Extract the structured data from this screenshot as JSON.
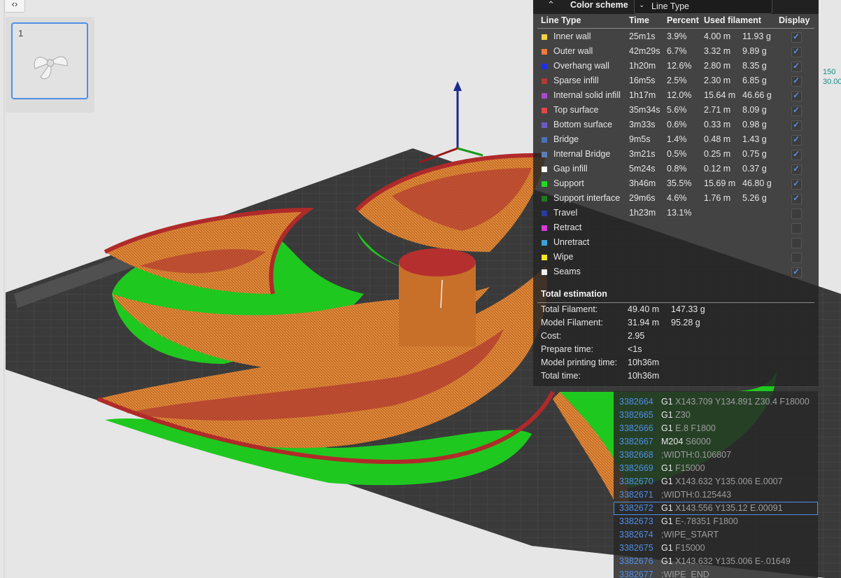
{
  "sidebar": {
    "collapse_icon": "‹›",
    "plate_number": "1"
  },
  "ruler": {
    "top": "150",
    "bottom": "30.00"
  },
  "legend": {
    "scheme_label": "Color scheme",
    "scheme_value": "Line Type",
    "headers": {
      "type": "Line Type",
      "time": "Time",
      "percent": "Percent",
      "used": "Used filament",
      "display": "Display"
    },
    "rows": [
      {
        "name": "Inner wall",
        "color": "#f5d33e",
        "time": "25m1s",
        "percent": "3.9%",
        "length": "4.00 m",
        "weight": "11.93 g",
        "display": true
      },
      {
        "name": "Outer wall",
        "color": "#f07c38",
        "time": "42m29s",
        "percent": "6.7%",
        "length": "3.32 m",
        "weight": "9.89 g",
        "display": true
      },
      {
        "name": "Overhang wall",
        "color": "#1f2ee8",
        "time": "1h20m",
        "percent": "12.6%",
        "length": "2.80 m",
        "weight": "8.35 g",
        "display": true
      },
      {
        "name": "Sparse infill",
        "color": "#b23a35",
        "time": "16m5s",
        "percent": "2.5%",
        "length": "2.30 m",
        "weight": "6.85 g",
        "display": true
      },
      {
        "name": "Internal solid infill",
        "color": "#a54bcf",
        "time": "1h17m",
        "percent": "12.0%",
        "length": "15.64 m",
        "weight": "46.66 g",
        "display": true
      },
      {
        "name": "Top surface",
        "color": "#e84545",
        "time": "35m34s",
        "percent": "5.6%",
        "length": "2.71 m",
        "weight": "8.09 g",
        "display": true
      },
      {
        "name": "Bottom surface",
        "color": "#6a5bc4",
        "time": "3m33s",
        "percent": "0.6%",
        "length": "0.33 m",
        "weight": "0.98 g",
        "display": true
      },
      {
        "name": "Bridge",
        "color": "#4a70b8",
        "time": "9m5s",
        "percent": "1.4%",
        "length": "0.48 m",
        "weight": "1.43 g",
        "display": true
      },
      {
        "name": "Internal Bridge",
        "color": "#5a7fb8",
        "time": "3m21s",
        "percent": "0.5%",
        "length": "0.25 m",
        "weight": "0.75 g",
        "display": true
      },
      {
        "name": "Gap infill",
        "color": "#ffffff",
        "time": "5m24s",
        "percent": "0.8%",
        "length": "0.12 m",
        "weight": "0.37 g",
        "display": true
      },
      {
        "name": "Support",
        "color": "#1fdc1f",
        "time": "3h46m",
        "percent": "35.5%",
        "length": "15.69 m",
        "weight": "46.80 g",
        "display": true
      },
      {
        "name": "Support interface",
        "color": "#1f7a1f",
        "time": "29m6s",
        "percent": "4.6%",
        "length": "1.76 m",
        "weight": "5.26 g",
        "display": true
      },
      {
        "name": "Travel",
        "color": "#2b3aa0",
        "time": "1h23m",
        "percent": "13.1%",
        "length": "",
        "weight": "",
        "display": false
      },
      {
        "name": "Retract",
        "color": "#d83ad8",
        "time": "",
        "percent": "",
        "length": "",
        "weight": "",
        "display": false
      },
      {
        "name": "Unretract",
        "color": "#3aa4d8",
        "time": "",
        "percent": "",
        "length": "",
        "weight": "",
        "display": false
      },
      {
        "name": "Wipe",
        "color": "#f5e61e",
        "time": "",
        "percent": "",
        "length": "",
        "weight": "",
        "display": false
      },
      {
        "name": "Seams",
        "color": "#f0f0f0",
        "time": "",
        "percent": "",
        "length": "",
        "weight": "",
        "display": true
      }
    ],
    "total_title": "Total estimation",
    "totals": [
      {
        "label": "Total Filament:",
        "v1": "49.40 m",
        "v2": "147.33 g"
      },
      {
        "label": "Model Filament:",
        "v1": "31.94 m",
        "v2": "95.28 g"
      },
      {
        "label": "Cost:",
        "v1": "2.95",
        "v2": ""
      },
      {
        "label": "Prepare time:",
        "v1": "<1s",
        "v2": ""
      },
      {
        "label": "Model printing time:",
        "v1": "10h36m",
        "v2": ""
      },
      {
        "label": "Total time:",
        "v1": "10h36m",
        "v2": ""
      }
    ]
  },
  "gcode": {
    "lines": [
      {
        "num": "3382664",
        "cmd": "G1",
        "args": "X143.709 Y134.891 Z30.4 F18000",
        "comment": false
      },
      {
        "num": "3382665",
        "cmd": "G1",
        "args": "Z30",
        "comment": false
      },
      {
        "num": "3382666",
        "cmd": "G1",
        "args": "E.8 F1800",
        "comment": false
      },
      {
        "num": "3382667",
        "cmd": "M204",
        "args": "S6000",
        "comment": false
      },
      {
        "num": "3382668",
        "cmd": ";WIDTH:0.106807",
        "args": "",
        "comment": true
      },
      {
        "num": "3382669",
        "cmd": "G1",
        "args": "F15000",
        "comment": false
      },
      {
        "num": "3382670",
        "cmd": "G1",
        "args": "X143.632 Y135.006 E.0007",
        "comment": false
      },
      {
        "num": "3382671",
        "cmd": ";WIDTH:0.125443",
        "args": "",
        "comment": true
      },
      {
        "num": "3382672",
        "cmd": "G1",
        "args": "X143.556 Y135.12 E.00091",
        "comment": false
      },
      {
        "num": "3382673",
        "cmd": "G1",
        "args": "E-.78351 F1800",
        "comment": false
      },
      {
        "num": "3382674",
        "cmd": ";WIPE_START",
        "args": "",
        "comment": true
      },
      {
        "num": "3382675",
        "cmd": "G1",
        "args": "F15000",
        "comment": false
      },
      {
        "num": "3382676",
        "cmd": "G1",
        "args": "X143.632 Y135.006 E-.01649",
        "comment": false
      },
      {
        "num": "3382677",
        "cmd": ";WIPE_END",
        "args": "",
        "comment": true
      }
    ],
    "selected_index": 8
  }
}
